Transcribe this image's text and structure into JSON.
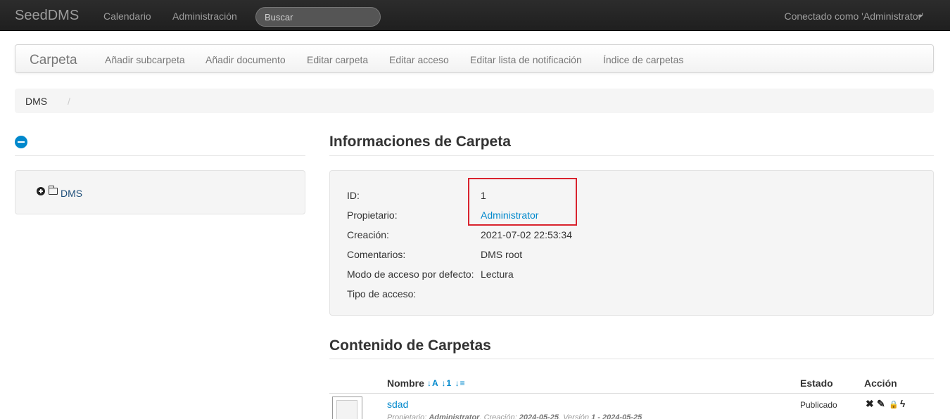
{
  "topbar": {
    "brand": "SeedDMS",
    "nav": [
      "Calendario",
      "Administración"
    ],
    "search_placeholder": "Buscar",
    "user": "Conectado como 'Administrator'"
  },
  "subnav": {
    "brand": "Carpeta",
    "items": [
      "Añadir subcarpeta",
      "Añadir documento",
      "Editar carpeta",
      "Editar acceso",
      "Editar lista de notificación",
      "Índice de carpetas"
    ]
  },
  "breadcrumb": {
    "items": [
      "DMS"
    ],
    "separator": "/"
  },
  "tree": {
    "root_label": "DMS"
  },
  "folder_info": {
    "title": "Informaciones de Carpeta",
    "fields": [
      {
        "label": "ID:",
        "value": "1"
      },
      {
        "label": "Propietario:",
        "value": "Administrator"
      },
      {
        "label": "Creación:",
        "value": "2021-07-02 22:53:34"
      },
      {
        "label": "Comentarios:",
        "value": "DMS root"
      },
      {
        "label": "Modo de acceso por defecto:",
        "value": "Lectura"
      },
      {
        "label": "Tipo de acceso:",
        "value": ""
      }
    ]
  },
  "contents": {
    "title": "Contenido de Carpetas",
    "columns": {
      "name": "Nombre",
      "status": "Estado",
      "action": "Acción"
    },
    "sort_icons": "↓A ↓1 ↓≡",
    "rows": [
      {
        "name": "sdad",
        "meta_owner_label": "Propietario:",
        "meta_owner": "Administrator",
        "meta_created_label": "Creación:",
        "meta_created": "2024-05-25",
        "meta_version_label": "Versión",
        "meta_version": "1 - 2024-05-25",
        "status": "Publicado",
        "actions": [
          "✖",
          "✎",
          "🔒",
          "ϟ"
        ]
      }
    ]
  },
  "colors": {
    "accent": "#0088cc",
    "highlight": "#d9232e",
    "navbar": "#222222"
  }
}
